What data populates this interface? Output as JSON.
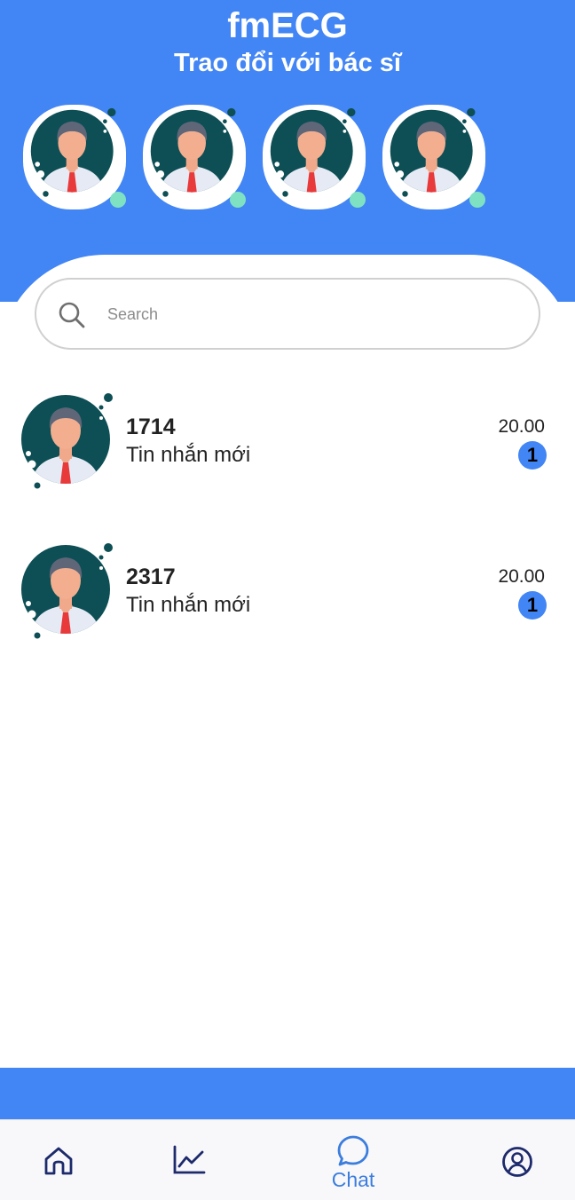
{
  "header": {
    "title": "fmECG",
    "subtitle": "Trao đổi với bác sĩ"
  },
  "stories": [
    {
      "avatar": "doctor-avatar",
      "online": true
    },
    {
      "avatar": "doctor-avatar",
      "online": true
    },
    {
      "avatar": "doctor-avatar",
      "online": true
    },
    {
      "avatar": "doctor-avatar",
      "online": true
    }
  ],
  "search": {
    "placeholder": "Search",
    "value": ""
  },
  "chats": [
    {
      "name": "1714",
      "preview": "Tin nhắn mới",
      "time": "20.00",
      "unread": "1"
    },
    {
      "name": "2317",
      "preview": "Tin nhắn mới",
      "time": "20.00",
      "unread": "1"
    }
  ],
  "nav": {
    "home_icon": "home-icon",
    "chart_icon": "line-chart-icon",
    "chat_icon": "chat-bubble-icon",
    "chat_label": "Chat",
    "profile_icon": "user-circle-icon",
    "active": "chat"
  },
  "colors": {
    "primary": "#4285f4",
    "avatar_bg": "#0d4f55",
    "online": "#7ee2c2",
    "nav_inactive": "#1d2a6b",
    "nav_active": "#3b7ddd"
  }
}
